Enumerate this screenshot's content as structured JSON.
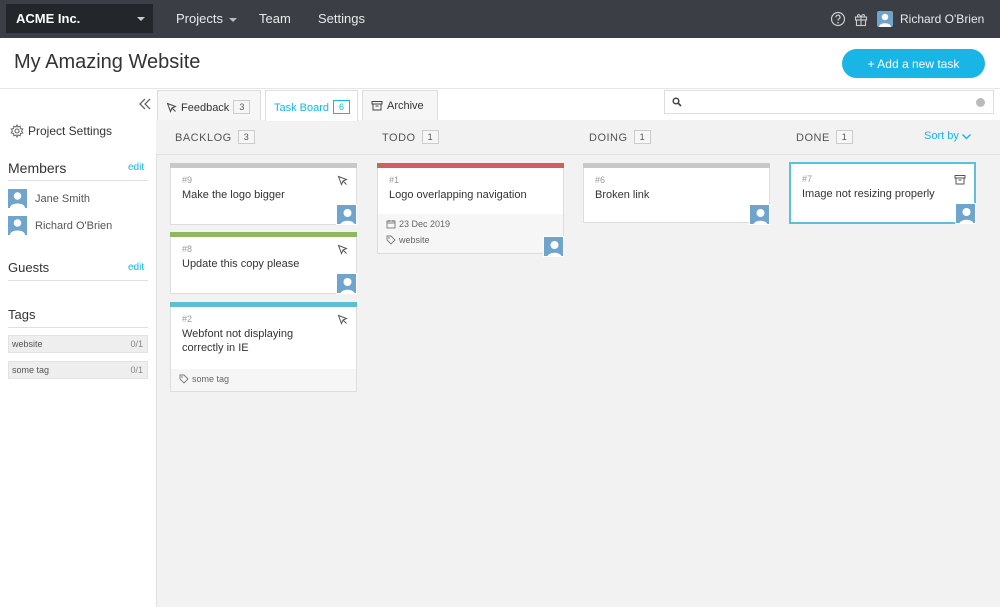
{
  "nav": {
    "org": "ACME Inc.",
    "links": [
      "Projects",
      "Team",
      "Settings"
    ],
    "user": "Richard O'Brien",
    "icons": [
      "help-icon",
      "gift-icon",
      "avatar"
    ]
  },
  "header": {
    "title": "My Amazing Website",
    "add_button": "+ Add a new task"
  },
  "sidebar": {
    "project_settings": "Project Settings",
    "members_title": "Members",
    "members_edit": "edit",
    "members": [
      "Jane Smith",
      "Richard O'Brien"
    ],
    "guests_title": "Guests",
    "guests_edit": "edit",
    "tags_title": "Tags",
    "tags": [
      {
        "name": "website",
        "count": "0/1"
      },
      {
        "name": "some tag",
        "count": "0/1"
      }
    ]
  },
  "tabs": [
    {
      "label": "Feedback",
      "count": "3",
      "icon": "pointer-icon"
    },
    {
      "label": "Task Board",
      "count": "6",
      "active": true
    },
    {
      "label": "Archive",
      "icon": "archive-icon"
    }
  ],
  "search": {
    "placeholder": "",
    "value": ""
  },
  "columns": [
    {
      "title": "BACKLOG",
      "count": "3"
    },
    {
      "title": "TODO",
      "count": "1"
    },
    {
      "title": "DOING",
      "count": "1"
    },
    {
      "title": "DONE",
      "count": "1"
    }
  ],
  "sort_by": "Sort by",
  "cards": [
    {
      "id": "#9",
      "title": "Make the logo bigger",
      "stripe": "#c8c8c8"
    },
    {
      "id": "#8",
      "title": "Update this copy please",
      "stripe": "#8db85e"
    },
    {
      "id": "#2",
      "title": "Webfont not displaying correctly in IE",
      "stripe": "#5bc0d3",
      "tag": "some tag"
    },
    {
      "id": "#1",
      "title": "Logo overlapping navigation",
      "stripe": "#d0605a",
      "date": "23 Dec 2019",
      "tag": "website"
    },
    {
      "id": "#6",
      "title": "Broken link",
      "stripe": "#c8c8c8"
    },
    {
      "id": "#7",
      "title": "Image not resizing properly",
      "stripe": "#5cc0d8"
    }
  ],
  "colors": {
    "accent": "#19b5e6",
    "nav_bg": "#3b3f45"
  }
}
